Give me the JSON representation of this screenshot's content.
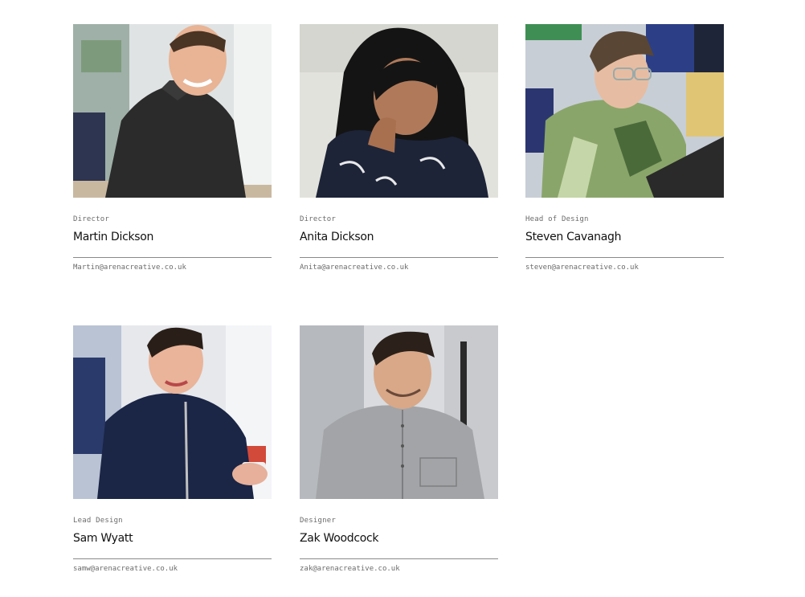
{
  "team": [
    {
      "role": "Director",
      "name": "Martin Dickson",
      "email": "Martin@arenacreative.co.uk"
    },
    {
      "role": "Director",
      "name": "Anita Dickson",
      "email": "Anita@arenacreative.co.uk"
    },
    {
      "role": "Head of Design",
      "name": "Steven Cavanagh",
      "email": "steven@arenacreative.co.uk"
    },
    {
      "role": "Lead Design",
      "name": "Sam Wyatt",
      "email": "samw@arenacreative.co.uk"
    },
    {
      "role": "Designer",
      "name": "Zak Woodcock",
      "email": "zak@arenacreative.co.uk"
    }
  ]
}
